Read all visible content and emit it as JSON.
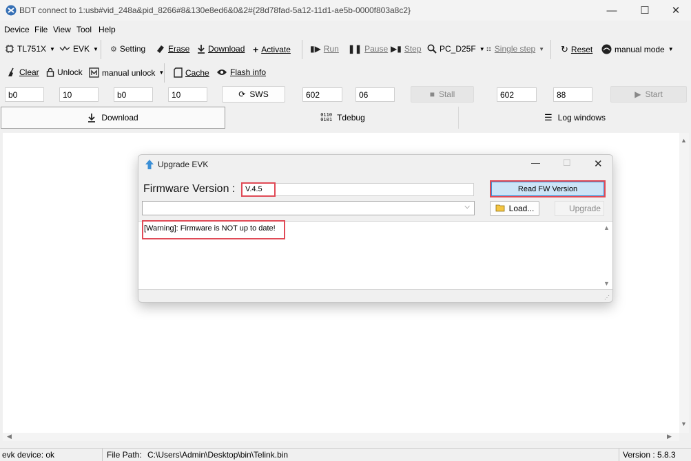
{
  "window": {
    "title": "BDT connect to 1:usb#vid_248a&pid_8266#8&130e8ed6&0&2#{28d78fad-5a12-11d1-ae5b-0000f803a8c2}",
    "controls": {
      "minimize": "—",
      "maximize": "☐",
      "close": "✕"
    }
  },
  "menu": [
    "Device",
    "File",
    "View",
    "Tool",
    "Help"
  ],
  "toolbar1": {
    "chip": "TL751X",
    "evk": "EVK",
    "setting": "Setting",
    "erase": "Erase",
    "download": "Download",
    "activate": "Activate",
    "run": "Run",
    "pause": "Pause",
    "step": "Step",
    "pc": "PC_D25F",
    "single_step": "Single step",
    "reset": "Reset",
    "manual_mode": "manual mode"
  },
  "toolbar2": {
    "clear": "Clear",
    "unlock": "Unlock",
    "manual_unlock": "manual unlock",
    "cache": "Cache",
    "flash_info": "Flash info"
  },
  "params": {
    "f1": "b0",
    "f2": "10",
    "f3": "b0",
    "f4": "10",
    "sws": "SWS",
    "f5": "602",
    "f6": "06",
    "stall": "Stall",
    "f7": "602",
    "f8": "88",
    "start": "Start"
  },
  "tabs": [
    {
      "label": "Download"
    },
    {
      "label": "Tdebug"
    },
    {
      "label": "Log windows"
    }
  ],
  "dialog": {
    "title": "Upgrade EVK",
    "controls": {
      "minimize": "—",
      "maximize": "☐",
      "close": "✕"
    },
    "fw_label": "Firmware Version :",
    "fw_value": "V.4.5",
    "read_btn": "Read FW Version",
    "load_btn": "Load...",
    "upgrade_btn": "Upgrade",
    "log": "[Warning]: Firmware is NOT up to date!"
  },
  "status": {
    "device": "evk device: ok",
    "file_path_label": "File Path:",
    "file_path": "C:\\Users\\Admin\\Desktop\\bin\\Telink.bin",
    "version": "Version : 5.8.3"
  },
  "colors": {
    "highlight": "#e04a56",
    "accent_blue": "#3b8fd6",
    "read_btn_bg": "#cce4f7"
  }
}
